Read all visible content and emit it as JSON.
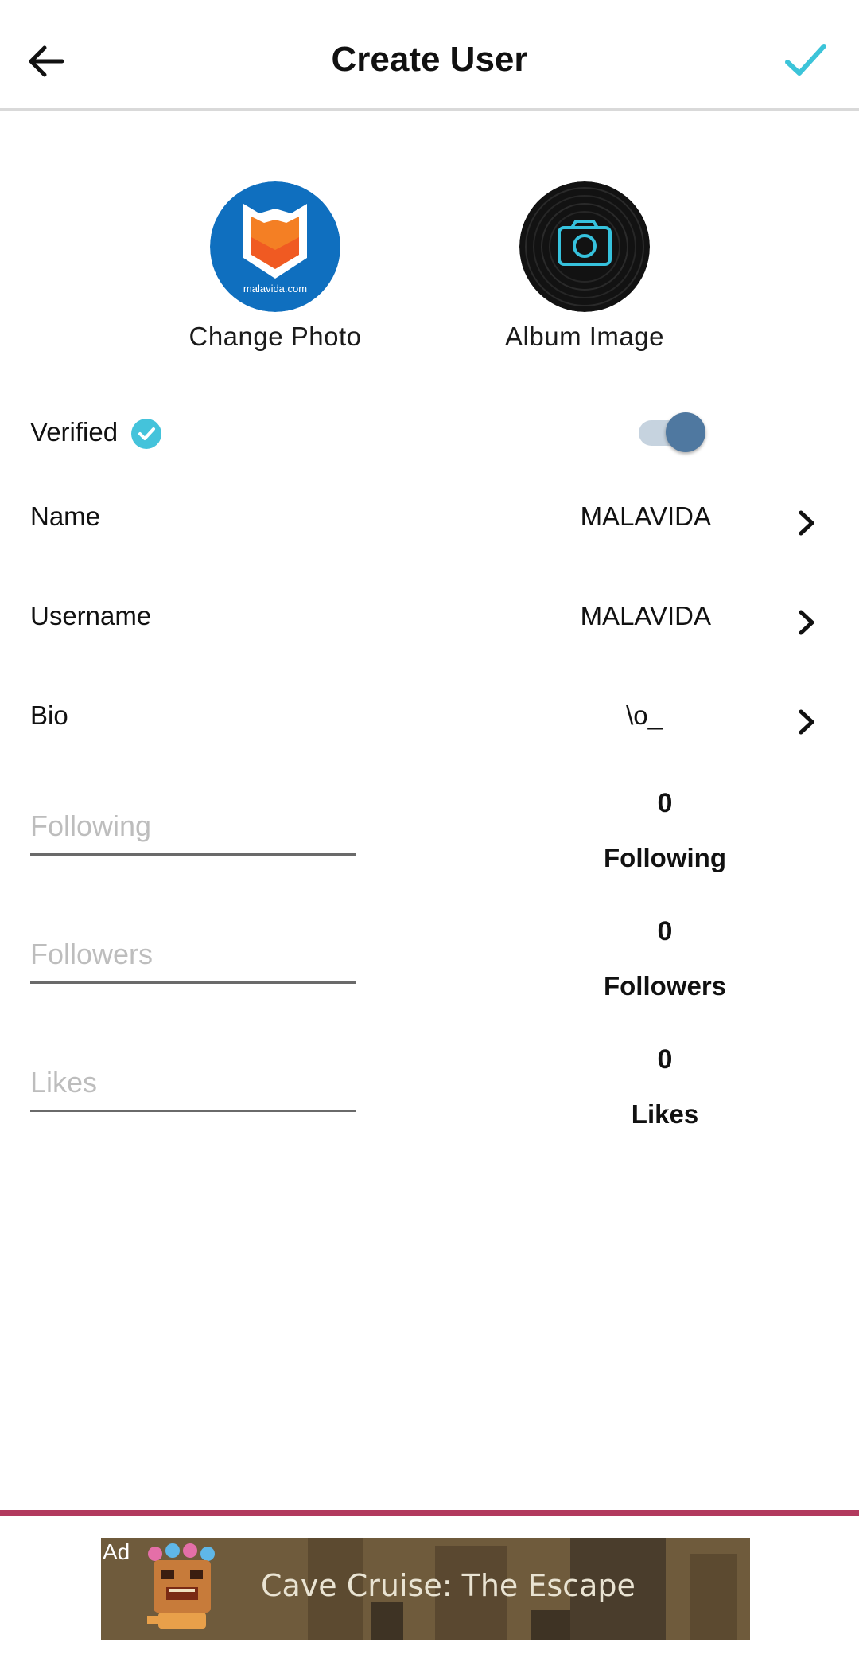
{
  "header": {
    "title": "Create User",
    "back_icon": "arrow-left-icon",
    "confirm_icon": "check-icon",
    "accent": "#3cc4d9"
  },
  "photos": {
    "change_label": "Change Photo",
    "album_label": "Album Image",
    "avatar_text": "malavida.com",
    "album_icon": "camera-icon"
  },
  "verified": {
    "label": "Verified",
    "badge_icon": "verified-check-icon",
    "enabled": true
  },
  "fields": [
    {
      "label": "Name",
      "value": "MALAVIDA"
    },
    {
      "label": "Username",
      "value": "MALAVIDA"
    },
    {
      "label": "Bio",
      "value": "\\o_"
    }
  ],
  "counters": [
    {
      "placeholder": "Following",
      "count": "0",
      "label": "Following"
    },
    {
      "placeholder": "Followers",
      "count": "0",
      "label": "Followers"
    },
    {
      "placeholder": "Likes",
      "count": "0",
      "label": "Likes"
    }
  ],
  "ad": {
    "tag": "Ad",
    "title": "Cave Cruise: The Escape",
    "line_color": "#b23a5e"
  }
}
